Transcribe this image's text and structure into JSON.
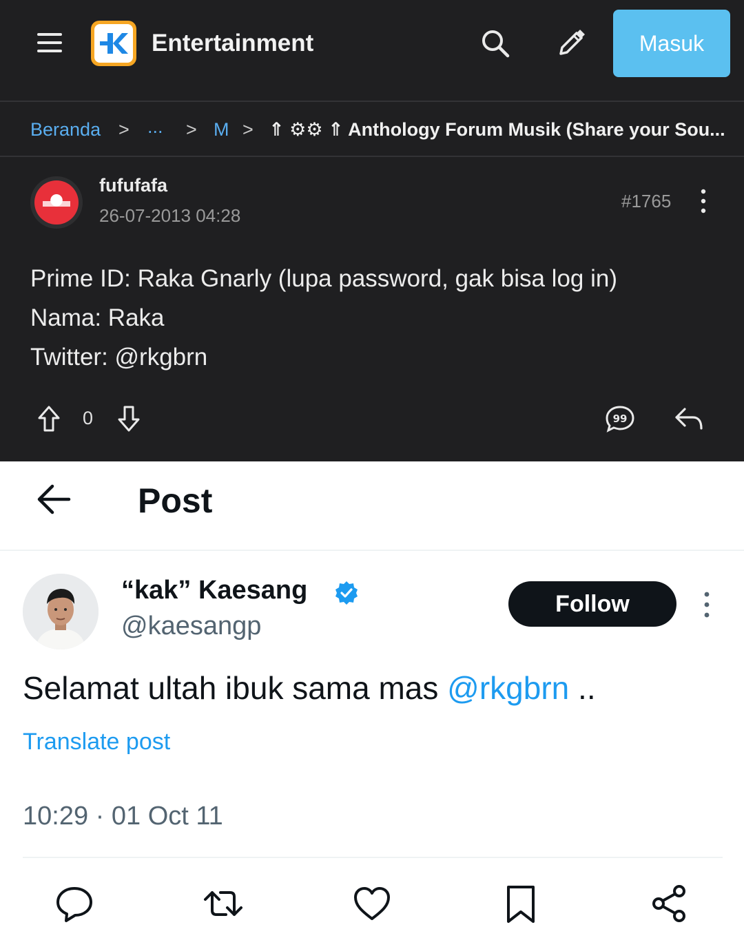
{
  "kaskus": {
    "header": {
      "title": "Entertainment",
      "login_label": "Masuk"
    },
    "breadcrumb": {
      "home": "Beranda",
      "ellipsis": "...",
      "level2": "M",
      "current": "⇑ ⚙⚙ ⇑ Anthology Forum Musik (Share your Sou..."
    },
    "post": {
      "username": "fufufafa",
      "datetime": "26-07-2013 04:28",
      "post_number": "#1765",
      "lines": [
        "Prime ID: Raka Gnarly (lupa password, gak bisa log in)",
        "Nama: Raka",
        "Twitter: @rkgbrn"
      ],
      "vote_count": "0"
    },
    "colors": {
      "background": "#1f1f21",
      "link": "#5aaef0",
      "login_button": "#5bc0f0",
      "logo": "#f6a623"
    },
    "icons": [
      "menu-icon",
      "search-icon",
      "pencil-icon",
      "kebab-icon",
      "upvote-icon",
      "downvote-icon",
      "quote-icon",
      "reply-icon"
    ]
  },
  "twitter": {
    "header": {
      "title": "Post"
    },
    "author": {
      "name": "“kak” Kaesang",
      "handle": "@kaesangp",
      "follow_label": "Follow"
    },
    "tweet": {
      "text_before": "Selamat ultah ibuk sama mas ",
      "mention": "@rkgbrn",
      "text_after": " ..",
      "translate_label": "Translate post",
      "timestamp": "10:29 · 01 Oct 11"
    },
    "colors": {
      "accent": "#1d9bf0",
      "text": "#0f1419",
      "muted": "#536471"
    },
    "icons": [
      "back-arrow-icon",
      "verified-badge-icon",
      "more-icon",
      "reply-icon",
      "retweet-icon",
      "like-icon",
      "bookmark-icon",
      "share-icon"
    ]
  }
}
